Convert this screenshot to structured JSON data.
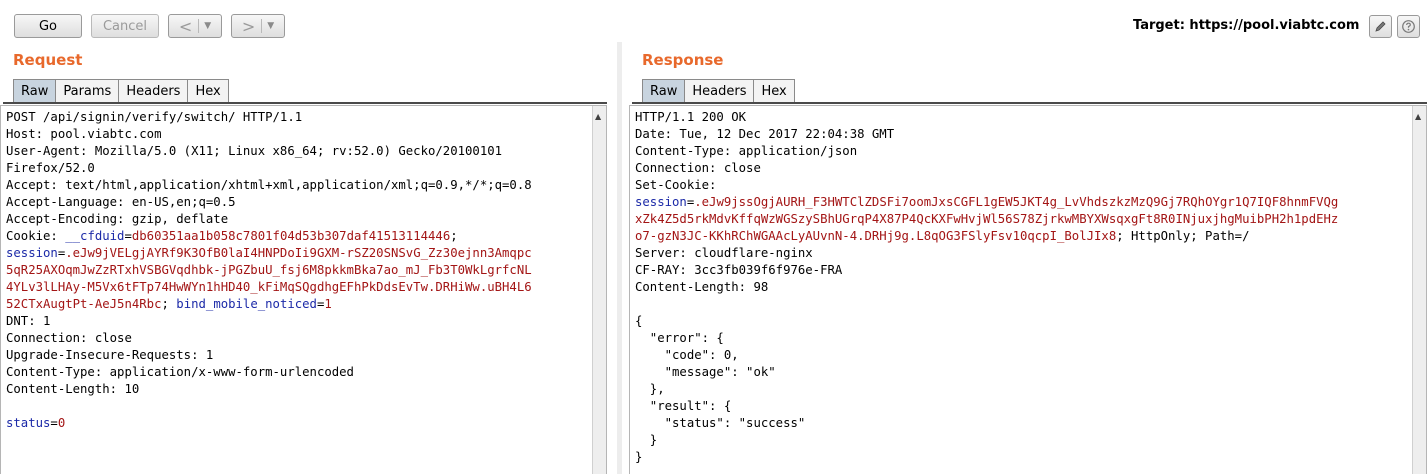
{
  "toolbar": {
    "go_label": "Go",
    "cancel_label": "Cancel",
    "back_icon": "chevron-left",
    "forward_icon": "chevron-right",
    "target_label": "Target: https://pool.viabtc.com",
    "edit_icon": "pencil-icon",
    "help_icon": "question-icon"
  },
  "request": {
    "title": "Request",
    "tabs": [
      "Raw",
      "Params",
      "Headers",
      "Hex"
    ],
    "active_tab": "Raw",
    "line1": "POST /api/signin/verify/switch/ HTTP/1.1",
    "line2": "Host: pool.viabtc.com",
    "line3": "User-Agent: Mozilla/5.0 (X11; Linux x86_64; rv:52.0) Gecko/20100101",
    "line4": "Firefox/52.0",
    "line5": "Accept: text/html,application/xhtml+xml,application/xml;q=0.9,*/*;q=0.8",
    "line6": "Accept-Language: en-US,en;q=0.5",
    "line7": "Accept-Encoding: gzip, deflate",
    "cookie_prefix": "Cookie: ",
    "cfduid_key": "__cfduid",
    "cfduid_val": "db60351aa1b058c7801f04d53b307daf41513114446",
    "sep1": "; ",
    "session_key": "session",
    "session_val_1": ".eJw9jVELgjAYRf9K3OfB0laI4HNPDoIi9GXM-rSZ20SNSvG_Zz30ejnn3Amqpc",
    "session_val_2": "5qR25AXOqmJwZzRTxhVSBGVqdhbk-jPGZbuU_fsj6M8pkkmBka7ao_mJ_Fb3T0WkLgrfcNL",
    "session_val_3": "4YLv3lLHAy-M5Vx6tFTp74HwWYn1hHD40_kFiMqSQgdhgEFhPkDdsEvTw.DRHiWw.uBH4L6",
    "session_val_4": "52CTxAugtPt-AeJ5n4Rbc",
    "sep2": "; ",
    "bind_key": "bind_mobile_noticed",
    "bind_val": "1",
    "dnt": "DNT: 1",
    "connection": "Connection: close",
    "upgrade": "Upgrade-Insecure-Requests: 1",
    "content_type": "Content-Type: application/x-www-form-urlencoded",
    "content_length": "Content-Length: 10",
    "body_key": "status",
    "body_val": "0"
  },
  "response": {
    "title": "Response",
    "tabs": [
      "Raw",
      "Headers",
      "Hex"
    ],
    "active_tab": "Raw",
    "line1": "HTTP/1.1 200 OK",
    "line2": "Date: Tue, 12 Dec 2017 22:04:38 GMT",
    "line3": "Content-Type: application/json",
    "line4": "Connection: close",
    "line5": "Set-Cookie:",
    "session_key": "session",
    "session_val_1": ".eJw9jssOgjAURH_F3HWTClZDSFi7oomJxsCGFL1gEW5JKT4g_LvVhdszkzMzQ9Gj7RQhOYgr1Q7IQF8hnmFVQg",
    "session_val_2": "xZk4Z5d5rkMdvKffqWzWGSzySBhUGrqP4X87P4QcKXFwHvjWl56S78ZjrkwMBYXWsqxgFt8R0INjuxjhgMuibPH2h1pdEHz",
    "session_val_3": "o7-gzN3JC-KKhRChWGAAcLyAUvnN-4.DRHj9g.L8qOG3FSlyFsv10qcpI_BolJIx8",
    "cookie_tail": "; HttpOnly; Path=/",
    "server": "Server: cloudflare-nginx",
    "cfray": "CF-RAY: 3cc3fb039f6f976e-FRA",
    "content_length": "Content-Length: 98",
    "json_1": "{",
    "json_2": "  \"error\": {",
    "json_3": "    \"code\": 0,",
    "json_4": "    \"message\": \"ok\"",
    "json_5": "  },",
    "json_6": "  \"result\": {",
    "json_7": "    \"status\": \"success\"",
    "json_8": "  }",
    "json_9": "}"
  }
}
